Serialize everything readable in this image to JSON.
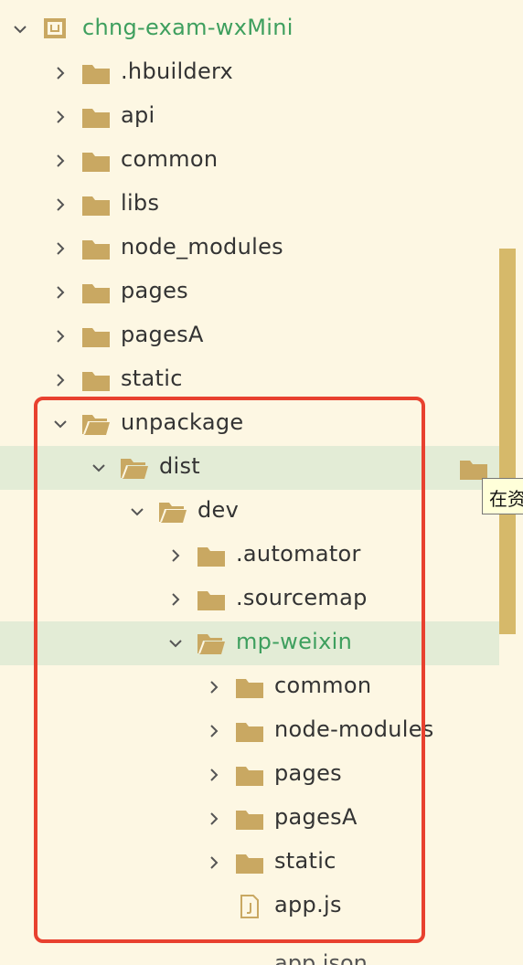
{
  "project": {
    "name": "chng-exam-wxMini"
  },
  "tree": [
    {
      "label": ".hbuilderx",
      "level": 0,
      "expanded": false,
      "type": "folder"
    },
    {
      "label": "api",
      "level": 0,
      "expanded": false,
      "type": "folder"
    },
    {
      "label": "common",
      "level": 0,
      "expanded": false,
      "type": "folder"
    },
    {
      "label": "libs",
      "level": 0,
      "expanded": false,
      "type": "folder"
    },
    {
      "label": "node_modules",
      "level": 0,
      "expanded": false,
      "type": "folder"
    },
    {
      "label": "pages",
      "level": 0,
      "expanded": false,
      "type": "folder"
    },
    {
      "label": "pagesA",
      "level": 0,
      "expanded": false,
      "type": "folder"
    },
    {
      "label": "static",
      "level": 0,
      "expanded": false,
      "type": "folder"
    },
    {
      "label": "unpackage",
      "level": 0,
      "expanded": true,
      "type": "folder"
    },
    {
      "label": "dist",
      "level": 1,
      "expanded": true,
      "type": "folder",
      "selected": true
    },
    {
      "label": "dev",
      "level": 2,
      "expanded": true,
      "type": "folder"
    },
    {
      "label": ".automator",
      "level": 3,
      "expanded": false,
      "type": "folder"
    },
    {
      "label": ".sourcemap",
      "level": 3,
      "expanded": false,
      "type": "folder"
    },
    {
      "label": "mp-weixin",
      "level": 3,
      "expanded": true,
      "type": "folder",
      "selected": true,
      "green": true
    },
    {
      "label": "common",
      "level": 4,
      "expanded": false,
      "type": "folder"
    },
    {
      "label": "node-modules",
      "level": 4,
      "expanded": false,
      "type": "folder"
    },
    {
      "label": "pages",
      "level": 4,
      "expanded": false,
      "type": "folder"
    },
    {
      "label": "pagesA",
      "level": 4,
      "expanded": false,
      "type": "folder"
    },
    {
      "label": "static",
      "level": 4,
      "expanded": false,
      "type": "folder"
    },
    {
      "label": "app.js",
      "level": 4,
      "type": "file"
    }
  ],
  "tooltip": {
    "text": "在资"
  },
  "cut_off_item": {
    "label": "app.json"
  },
  "colors": {
    "background": "#fdf7e3",
    "selection": "#e3ecd6",
    "folder": "#c9a862",
    "accent_text": "#3e9f5e",
    "highlight_box": "#e8412f",
    "scrollbar": "#d6b96a"
  }
}
